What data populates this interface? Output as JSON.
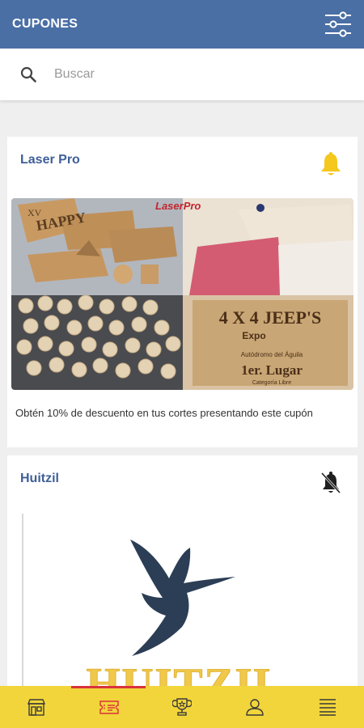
{
  "header": {
    "title": "CUPONES",
    "filter_icon": "sliders-icon",
    "bg_color": "#4a6fa5"
  },
  "search": {
    "placeholder": "Buscar",
    "value": "",
    "icon": "search-icon"
  },
  "coupons": [
    {
      "business": "Laser Pro",
      "notifications": "on",
      "bell_color": "#f4c81c",
      "image_texts": {
        "logo": "LaserPro",
        "sign_line1": "4 X 4 JEEP'S",
        "sign_line2": "Expo",
        "sign_line3": "Autódromo del Águila",
        "sign_line4": "1er. Lugar",
        "sign_line5": "Categoría Libre",
        "wood_text": "HAPPY",
        "year_text": "XV"
      },
      "description": "Obtén 10% de descuento en tus cortes presentando este cupón"
    },
    {
      "business": "Huitzil",
      "notifications": "off",
      "logo_text": "HUITZIL"
    }
  ],
  "bottom_nav": {
    "bg_color": "#f2d53a",
    "active_index": 1,
    "items": [
      {
        "icon": "store-icon"
      },
      {
        "icon": "coupon-icon"
      },
      {
        "icon": "trophy-icon"
      },
      {
        "icon": "user-icon"
      },
      {
        "icon": "menu-icon"
      }
    ]
  }
}
